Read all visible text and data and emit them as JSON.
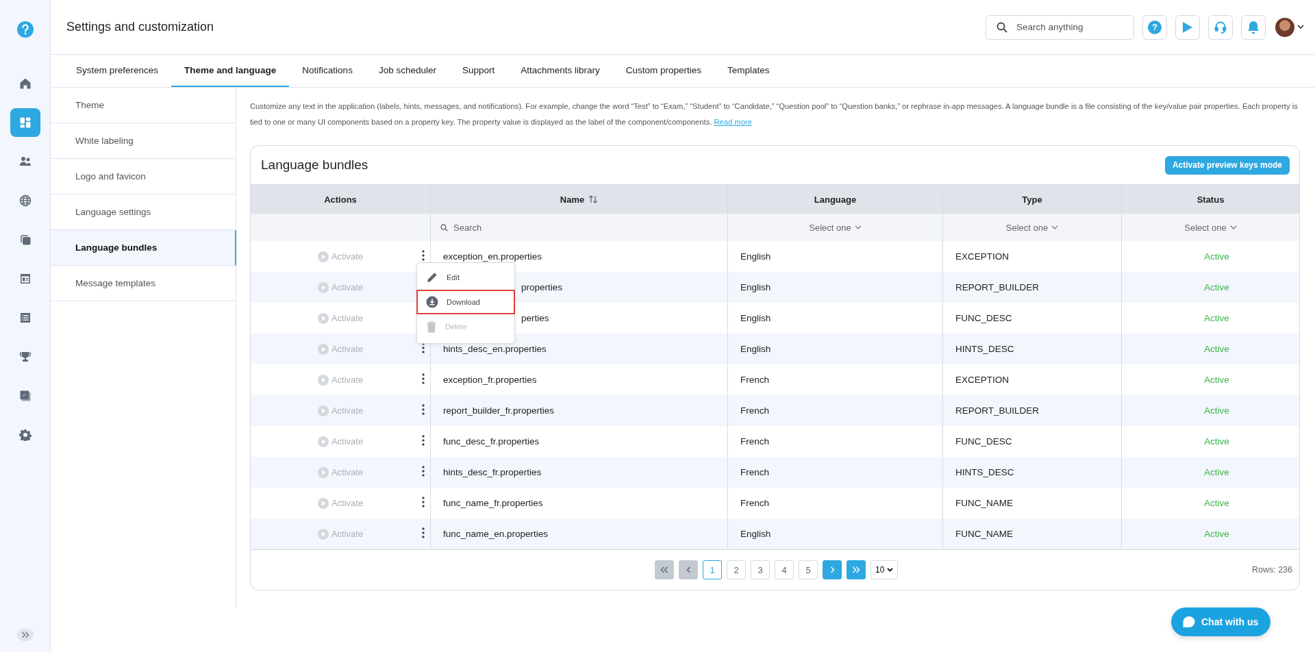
{
  "header": {
    "title": "Settings and customization",
    "search": {
      "placeholder": "Search anything"
    },
    "help": "?"
  },
  "rail": [
    {
      "selected": false
    },
    {
      "selected": true
    },
    {
      "selected": false
    },
    {
      "selected": false
    },
    {
      "selected": false
    },
    {
      "selected": false
    },
    {
      "selected": false
    },
    {
      "selected": false
    },
    {
      "selected": false
    },
    {
      "selected": false
    }
  ],
  "tabs": [
    {
      "label": "System preferences",
      "selected": false
    },
    {
      "label": "Theme and language",
      "selected": true
    },
    {
      "label": "Notifications",
      "selected": false
    },
    {
      "label": "Job scheduler",
      "selected": false
    },
    {
      "label": "Support",
      "selected": false
    },
    {
      "label": "Attachments library",
      "selected": false
    },
    {
      "label": "Custom properties",
      "selected": false
    },
    {
      "label": "Templates",
      "selected": false
    }
  ],
  "subnav": [
    {
      "label": "Theme",
      "selected": false
    },
    {
      "label": "White labeling",
      "selected": false
    },
    {
      "label": "Logo and favicon",
      "selected": false
    },
    {
      "label": "Language settings",
      "selected": false
    },
    {
      "label": "Language bundles",
      "selected": true
    },
    {
      "label": "Message templates",
      "selected": false
    }
  ],
  "description": {
    "text": "Customize any text in the application (labels, hints, messages, and notifications). For example, change the word “Test” to “Exam,” “Student” to “Candidate,” “Question pool” to “Question banks,” or rephrase in-app messages. A language bundle is a file consisting of the key/value pair properties. Each property is tied to one or many UI components based on a property key. The property value is displayed as the label of the component/components.",
    "link": "Read more"
  },
  "card": {
    "title": "Language bundles",
    "button": "Activate preview keys mode"
  },
  "columns": [
    {
      "label": "Actions",
      "sortable": false
    },
    {
      "label": "Name",
      "sortable": true
    },
    {
      "label": "Language",
      "sortable": false
    },
    {
      "label": "Type",
      "sortable": false
    },
    {
      "label": "Status",
      "sortable": false
    }
  ],
  "filters": {
    "name": {
      "placeholder": "Search"
    },
    "language": "Select one",
    "type": "Select one",
    "status": "Select one"
  },
  "rows": [
    {
      "action": "Activate",
      "name": "exception_en.properties",
      "name_hidden": false,
      "language": "English",
      "type": "EXCEPTION",
      "status": "Active"
    },
    {
      "action": "Activate",
      "name": "properties",
      "name_hidden": true,
      "covered_by_menu": true,
      "language": "English",
      "type": "REPORT_BUILDER",
      "status": "Active"
    },
    {
      "action": "Activate",
      "name": "perties",
      "name_hidden": true,
      "covered_by_menu": true,
      "language": "English",
      "type": "FUNC_DESC",
      "status": "Active"
    },
    {
      "action": "Activate",
      "name": "hints_desc_en.properties",
      "name_hidden": false,
      "language": "English",
      "type": "HINTS_DESC",
      "status": "Active"
    },
    {
      "action": "Activate",
      "name": "exception_fr.properties",
      "name_hidden": false,
      "language": "French",
      "type": "EXCEPTION",
      "status": "Active"
    },
    {
      "action": "Activate",
      "name": "report_builder_fr.properties",
      "name_hidden": false,
      "language": "French",
      "type": "REPORT_BUILDER",
      "status": "Active"
    },
    {
      "action": "Activate",
      "name": "func_desc_fr.properties",
      "name_hidden": false,
      "language": "French",
      "type": "FUNC_DESC",
      "status": "Active"
    },
    {
      "action": "Activate",
      "name": "hints_desc_fr.properties",
      "name_hidden": false,
      "language": "French",
      "type": "HINTS_DESC",
      "status": "Active"
    },
    {
      "action": "Activate",
      "name": "func_name_fr.properties",
      "name_hidden": false,
      "language": "French",
      "type": "FUNC_NAME",
      "status": "Active"
    },
    {
      "action": "Activate",
      "name": "func_name_en.properties",
      "name_hidden": false,
      "language": "English",
      "type": "FUNC_NAME",
      "status": "Active"
    }
  ],
  "row_menu": [
    {
      "kind": "edit",
      "label": "Edit",
      "disabled": false,
      "highlighted": false
    },
    {
      "kind": "download",
      "label": "Download",
      "disabled": false,
      "highlighted": true
    },
    {
      "kind": "delete",
      "label": "Delete",
      "disabled": true,
      "highlighted": false
    }
  ],
  "pagination": {
    "nav_start": [
      {
        "kind": "first",
        "disabled": true
      },
      {
        "kind": "prev",
        "disabled": true
      }
    ],
    "pages": [
      {
        "label": "1",
        "selected": true
      },
      {
        "label": "2",
        "selected": false
      },
      {
        "label": "3",
        "selected": false
      },
      {
        "label": "4",
        "selected": false
      },
      {
        "label": "5",
        "selected": false
      }
    ],
    "nav_end": [
      {
        "kind": "next",
        "disabled": false
      },
      {
        "kind": "last",
        "disabled": false
      }
    ],
    "page_size": "10",
    "rows": "Rows: 236"
  },
  "chat": {
    "label": "Chat with us"
  }
}
